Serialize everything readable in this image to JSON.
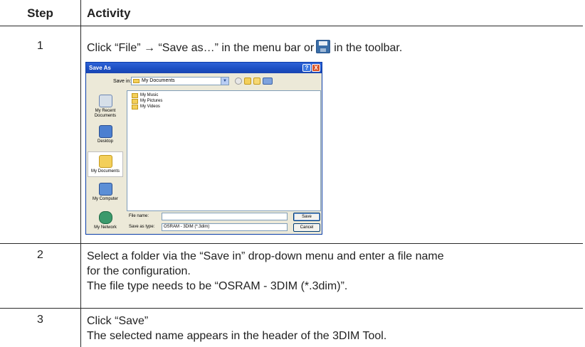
{
  "table": {
    "header_step": "Step",
    "header_activity": "Activity"
  },
  "steps": [
    {
      "number": "1",
      "text_before_icon": "Click “File” → “Save as…” in the menu bar or",
      "text_after_icon": "in the toolbar.",
      "icon": "save-icon"
    },
    {
      "number": "2",
      "line1": "Select a folder via the “Save in” drop-down menu and enter a file name",
      "line2": "for the configuration.",
      "line3": "The file type needs to be “OSRAM - 3DIM (*.3dim)”."
    },
    {
      "number": "3",
      "line1": "Click “Save”",
      "line2": "The selected name appears in the header of the 3DIM Tool."
    }
  ],
  "dialog": {
    "title": "Save As",
    "help_btn": "?",
    "close_btn": "X",
    "save_in_label": "Save in:",
    "save_in_value": "My Documents",
    "places": [
      "My Recent Documents",
      "Desktop",
      "My Documents",
      "My Computer",
      "My Network"
    ],
    "files": [
      "My Music",
      "My Pictures",
      "My Videos"
    ],
    "file_name_label": "File name:",
    "file_name_value": "",
    "save_type_label": "Save as type:",
    "save_type_value": "OSRAM - 3DIM (*.3dim)",
    "save_button": "Save",
    "cancel_button": "Cancel"
  }
}
